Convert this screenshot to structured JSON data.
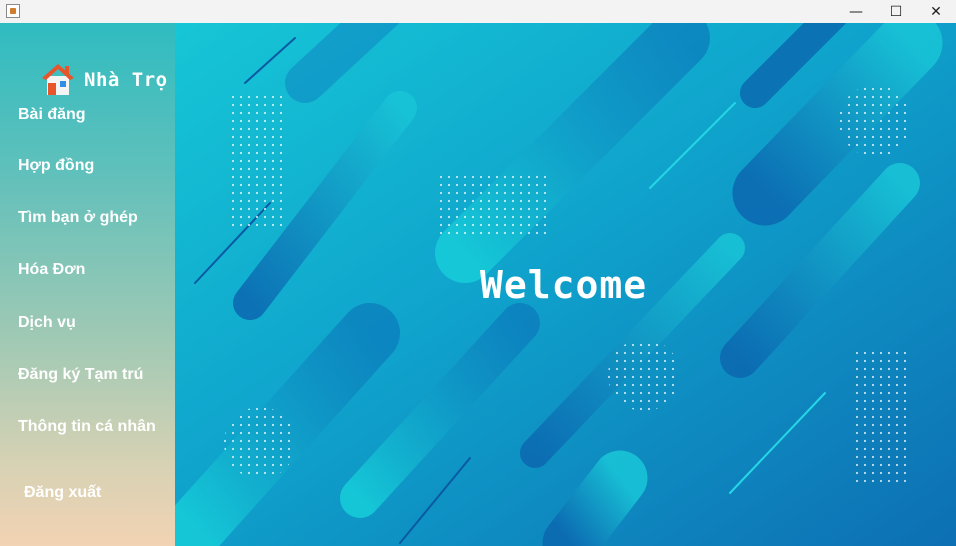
{
  "window": {
    "minimize_glyph": "—",
    "maximize_glyph": "☐",
    "close_glyph": "✕"
  },
  "sidebar": {
    "brand": "Nhà Trọ",
    "logo_icon": "house-icon",
    "items": [
      {
        "label": "Bài đăng"
      },
      {
        "label": "Hợp đồng"
      },
      {
        "label": "Tìm bạn ở ghép"
      },
      {
        "label": "Hóa Đơn"
      },
      {
        "label": "Dịch vụ"
      },
      {
        "label": "Đăng ký Tạm trú"
      },
      {
        "label": "Thông tin cá nhân"
      }
    ],
    "logout": "Đăng xuất"
  },
  "main": {
    "welcome": "Welcome"
  },
  "colors": {
    "sidebar_top": "#2fbcc1",
    "sidebar_bottom": "#f2d3b3",
    "main_bg": "#1497c6"
  }
}
